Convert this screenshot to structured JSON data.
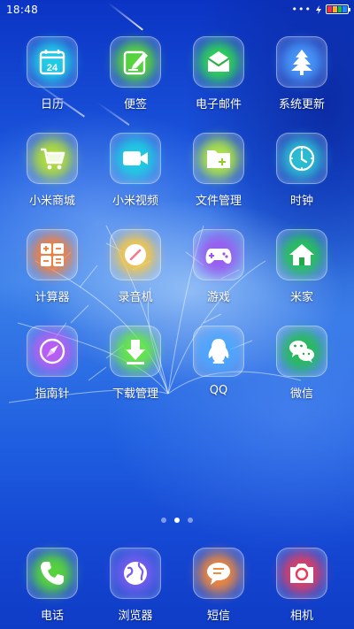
{
  "status_bar": {
    "time": "18:48",
    "dots": "•••",
    "battery_colors": [
      "#ff2f2f",
      "#ffb21a",
      "#22c03a",
      "#1e8bff"
    ]
  },
  "home": {
    "apps": [
      {
        "label": "日历",
        "icon": "calendar-icon",
        "glow": "#1fd8e8",
        "day": "24"
      },
      {
        "label": "便签",
        "icon": "notes-icon",
        "glow": "#5de22d"
      },
      {
        "label": "电子邮件",
        "icon": "mail-icon",
        "glow": "#2fe04a"
      },
      {
        "label": "系统更新",
        "icon": "tree-icon",
        "glow": "#4a9cff"
      },
      {
        "label": "小米商城",
        "icon": "cart-icon",
        "glow": "#b9e52d"
      },
      {
        "label": "小米视频",
        "icon": "video-camera-icon",
        "glow": "#19d5e2"
      },
      {
        "label": "文件管理",
        "icon": "folder-icon",
        "glow": "#b8f03a"
      },
      {
        "label": "时钟",
        "icon": "clock-icon",
        "glow": "#2bc8d4"
      },
      {
        "label": "计算器",
        "icon": "calculator-icon",
        "glow": "#ff7d2e"
      },
      {
        "label": "录音机",
        "icon": "recorder-icon",
        "glow": "#ffc93a"
      },
      {
        "label": "游戏",
        "icon": "gamepad-icon",
        "glow": "#9c55f0"
      },
      {
        "label": "米家",
        "icon": "home-icon",
        "glow": "#22c94a"
      },
      {
        "label": "指南针",
        "icon": "compass-icon",
        "glow": "#c45af5"
      },
      {
        "label": "下载管理",
        "icon": "download-icon",
        "glow": "#66ee3a"
      },
      {
        "label": "QQ",
        "icon": "qq-penguin-icon",
        "glow": "#48a8ff"
      },
      {
        "label": "微信",
        "icon": "wechat-icon",
        "glow": "#22c14a"
      }
    ],
    "pages": 3,
    "current_page": 2
  },
  "dock": {
    "apps": [
      {
        "label": "电话",
        "icon": "phone-icon",
        "glow": "#5ae02d"
      },
      {
        "label": "浏览器",
        "icon": "globe-icon",
        "glow": "#7b5cf2"
      },
      {
        "label": "短信",
        "icon": "message-icon",
        "glow": "#ff8c2e"
      },
      {
        "label": "相机",
        "icon": "camera-icon",
        "glow": "#f03a5a"
      }
    ]
  }
}
